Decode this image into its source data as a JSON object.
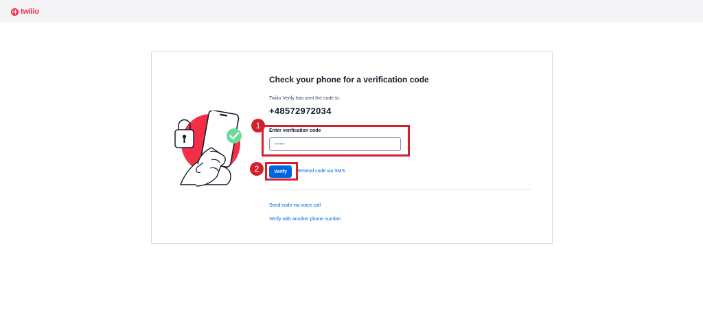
{
  "header": {
    "logo_text": "twilio",
    "logo_color": "#f22f46"
  },
  "verify": {
    "title": "Check your phone for a verification code",
    "sent_label": "Twilio Verify has sent the code to:",
    "phone_number": "+48572972034",
    "code_label": "Enter verification code",
    "code_value": "••••••",
    "verify_button": "Verify",
    "resend_link": "Resend code via SMS",
    "voice_link": "Send code via voice call",
    "other_number_link": "Verify with another phone number"
  },
  "annotations": {
    "step1": "1",
    "step2": "2",
    "color": "#d51f2b"
  },
  "colors": {
    "primary": "#0263e0",
    "brand": "#f22f46",
    "success": "#14b053"
  }
}
